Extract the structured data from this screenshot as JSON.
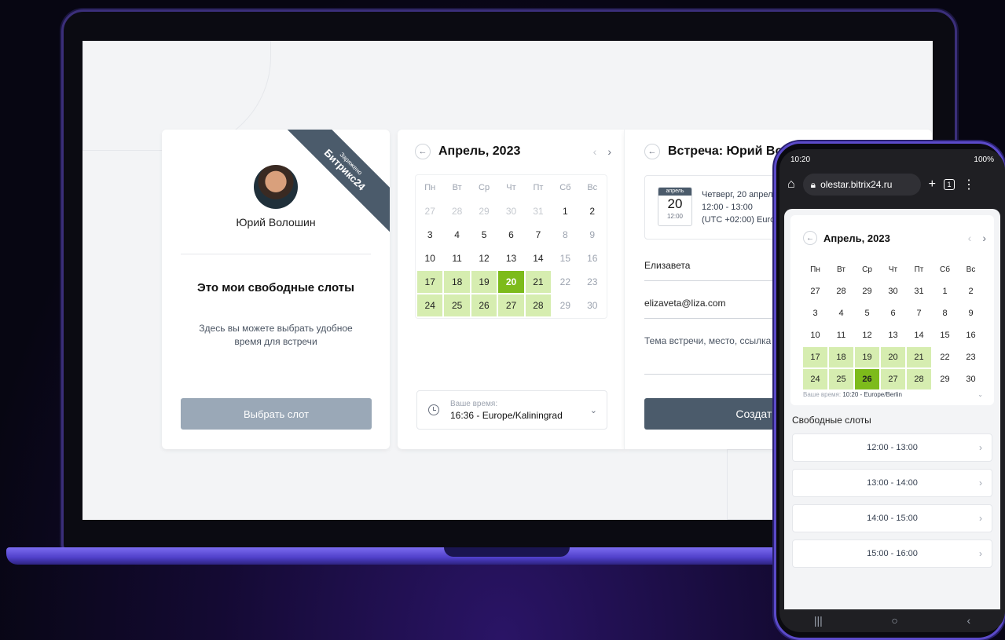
{
  "profile": {
    "name": "Юрий Волошин",
    "heading": "Это мои свободные слоты",
    "description": "Здесь вы можете выбрать удобное время для встречи",
    "select_button": "Выбрать слот",
    "ribbon_small": "Заряжено",
    "ribbon_brand": "Битрикс24"
  },
  "calendar": {
    "title": "Апрель, 2023",
    "weekdays": [
      "Пн",
      "Вт",
      "Ср",
      "Чт",
      "Пт",
      "Сб",
      "Вс"
    ],
    "days": [
      {
        "d": "27",
        "s": "muted"
      },
      {
        "d": "28",
        "s": "muted"
      },
      {
        "d": "29",
        "s": "muted"
      },
      {
        "d": "30",
        "s": "muted"
      },
      {
        "d": "31",
        "s": "muted"
      },
      {
        "d": "1",
        "s": "normal"
      },
      {
        "d": "2",
        "s": "normal"
      },
      {
        "d": "3",
        "s": "normal"
      },
      {
        "d": "4",
        "s": "normal"
      },
      {
        "d": "5",
        "s": "normal"
      },
      {
        "d": "6",
        "s": "normal"
      },
      {
        "d": "7",
        "s": "normal"
      },
      {
        "d": "8",
        "s": "weekend"
      },
      {
        "d": "9",
        "s": "weekend"
      },
      {
        "d": "10",
        "s": "normal"
      },
      {
        "d": "11",
        "s": "normal"
      },
      {
        "d": "12",
        "s": "normal"
      },
      {
        "d": "13",
        "s": "normal"
      },
      {
        "d": "14",
        "s": "normal"
      },
      {
        "d": "15",
        "s": "weekend"
      },
      {
        "d": "16",
        "s": "weekend"
      },
      {
        "d": "17",
        "s": "avail"
      },
      {
        "d": "18",
        "s": "avail"
      },
      {
        "d": "19",
        "s": "avail"
      },
      {
        "d": "20",
        "s": "sel"
      },
      {
        "d": "21",
        "s": "avail"
      },
      {
        "d": "22",
        "s": "weekend"
      },
      {
        "d": "23",
        "s": "weekend"
      },
      {
        "d": "24",
        "s": "avail"
      },
      {
        "d": "25",
        "s": "avail"
      },
      {
        "d": "26",
        "s": "avail"
      },
      {
        "d": "27",
        "s": "avail"
      },
      {
        "d": "28",
        "s": "avail"
      },
      {
        "d": "29",
        "s": "weekend"
      },
      {
        "d": "30",
        "s": "weekend"
      }
    ],
    "timezone_label": "Ваше время:",
    "timezone_value": "16:36 - Europe/Kaliningrad"
  },
  "form": {
    "title": "Встреча: Юрий Волошин",
    "badge_month": "апрель",
    "badge_day": "20",
    "badge_time": "12:00",
    "info_line1": "Четверг, 20 апреля",
    "info_line2": "12:00 - 13:00",
    "info_line3": "(UTC +02:00) Europe/Kaliningrad",
    "name_value": "Елизавета",
    "email_value": "elizaveta@liza.com",
    "topic_placeholder": "Тема встречи, место, ссылка",
    "create_button": "Создать встречу"
  },
  "phone": {
    "status_time": "10:20",
    "status_right": "100%",
    "url": "olestar.bitrix24.ru",
    "tab_count": "1",
    "calendar_title": "Апрель, 2023",
    "days": [
      {
        "d": "27",
        "s": "muted"
      },
      {
        "d": "28",
        "s": "muted"
      },
      {
        "d": "29",
        "s": "muted"
      },
      {
        "d": "30",
        "s": "muted"
      },
      {
        "d": "31",
        "s": "muted"
      },
      {
        "d": "1",
        "s": "weekend"
      },
      {
        "d": "2",
        "s": "weekend"
      },
      {
        "d": "3",
        "s": "normal"
      },
      {
        "d": "4",
        "s": "normal"
      },
      {
        "d": "5",
        "s": "normal"
      },
      {
        "d": "6",
        "s": "normal"
      },
      {
        "d": "7",
        "s": "normal"
      },
      {
        "d": "8",
        "s": "weekend"
      },
      {
        "d": "9",
        "s": "weekend"
      },
      {
        "d": "10",
        "s": "normal"
      },
      {
        "d": "11",
        "s": "normal"
      },
      {
        "d": "12",
        "s": "normal"
      },
      {
        "d": "13",
        "s": "normal"
      },
      {
        "d": "14",
        "s": "normal"
      },
      {
        "d": "15",
        "s": "weekend"
      },
      {
        "d": "16",
        "s": "weekend"
      },
      {
        "d": "17",
        "s": "avail"
      },
      {
        "d": "18",
        "s": "avail"
      },
      {
        "d": "19",
        "s": "avail"
      },
      {
        "d": "20",
        "s": "avail"
      },
      {
        "d": "21",
        "s": "avail"
      },
      {
        "d": "22",
        "s": "weekend"
      },
      {
        "d": "23",
        "s": "weekend"
      },
      {
        "d": "24",
        "s": "avail"
      },
      {
        "d": "25",
        "s": "avail"
      },
      {
        "d": "26",
        "s": "sel"
      },
      {
        "d": "27",
        "s": "avail"
      },
      {
        "d": "28",
        "s": "avail"
      },
      {
        "d": "29",
        "s": "weekend"
      },
      {
        "d": "30",
        "s": "weekend"
      }
    ],
    "tz_label": "Ваше время:",
    "tz_value": "10:20 - Europe/Berlin",
    "slots_title": "Свободные слоты",
    "slots": [
      "12:00 - 13:00",
      "13:00 - 14:00",
      "14:00 - 15:00",
      "15:00 - 16:00"
    ]
  },
  "colors": {
    "available": "#d6edb0",
    "selected": "#7dbb1b",
    "primary_button": "#4b5b6b",
    "disabled_button": "#9aa8b7"
  }
}
